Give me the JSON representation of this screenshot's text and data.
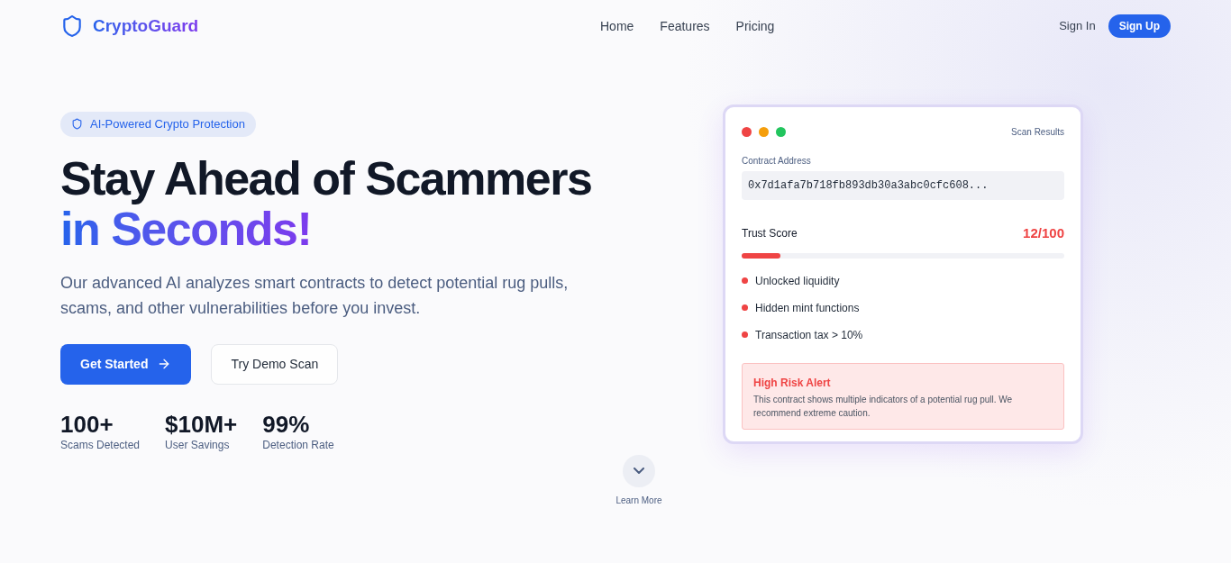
{
  "brand": "CryptoGuard",
  "nav": [
    "Home",
    "Features",
    "Pricing"
  ],
  "auth": {
    "sign_in": "Sign In",
    "sign_up": "Sign Up"
  },
  "hero": {
    "badge": "AI-Powered Crypto Protection",
    "title_line1": "Stay Ahead of Scammers",
    "title_line2": "in Seconds!",
    "description": "Our advanced AI analyzes smart contracts to detect potential rug pulls, scams, and other vulnerabilities before you invest.",
    "primary_button": "Get Started",
    "secondary_button": "Try Demo Scan",
    "stats": [
      {
        "value": "100+",
        "label": "Scams Detected"
      },
      {
        "value": "$10M+",
        "label": "User Savings"
      },
      {
        "value": "99%",
        "label": "Detection Rate"
      }
    ]
  },
  "scan_card": {
    "window_dots": [
      {
        "color": "#ef4444"
      },
      {
        "color": "#f59e0b"
      },
      {
        "color": "#22c55e"
      }
    ],
    "title": "Scan Results",
    "address_label": "Contract Address",
    "address": "0x7d1afa7b718fb893db30a3abc0cfc608...",
    "trust_label": "Trust Score",
    "trust_value": "12/100",
    "level": 0.12,
    "risks": [
      "Unlocked liquidity",
      "Hidden mint functions",
      "Transaction tax > 10%"
    ],
    "alert": {
      "title": "High Risk Alert",
      "text": "This contract shows multiple indicators of a potential rug pull. We recommend extreme caution."
    }
  },
  "learn_more": "Learn More"
}
